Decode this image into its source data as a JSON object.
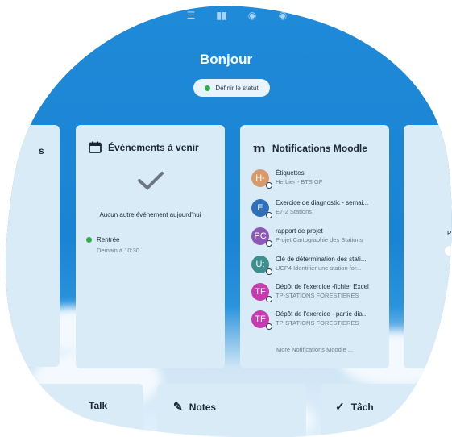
{
  "header": {
    "greeting": "Bonjour",
    "status_button": "Définir le statut",
    "icons": [
      "list-icon",
      "bar-chart-icon",
      "globe-icon",
      "globe-icon"
    ]
  },
  "left_partial_card": {
    "label": "s"
  },
  "events": {
    "title": "Événements à venir",
    "empty_message": "Aucun autre événement aujourd'hui",
    "items": [
      {
        "title": "Rentrée",
        "time": "Demain à 10:30",
        "color": "#2db24a"
      }
    ]
  },
  "moodle": {
    "title": "Notifications Moodle",
    "items": [
      {
        "initials": "H-",
        "title": "Étiquettes",
        "subtitle": "Herbier - BTS GF",
        "color": "#d89a6a"
      },
      {
        "initials": "E",
        "title": "Exercice de diagnostic - semai...",
        "subtitle": "E7-2 Stations",
        "color": "#2d6fb8"
      },
      {
        "initials": "PC",
        "title": "rapport de projet",
        "subtitle": "Projet Cartographie des Stations",
        "color": "#8c57b5"
      },
      {
        "initials": "U:",
        "title": "Clé de détermination des stati...",
        "subtitle": "UCP4 Identifier une station for...",
        "color": "#3f8f8f"
      },
      {
        "initials": "TF",
        "title": "Dépôt de l'exercice -fichier Excel",
        "subtitle": "TP-STATIONS FORESTIERES",
        "color": "#c63bb0"
      },
      {
        "initials": "TF",
        "title": "Dépôt de l'exercice - partie dia...",
        "subtitle": "TP-STATIONS FORESTIERES",
        "color": "#c63bb0"
      }
    ],
    "more": "More Notifications Moodle ..."
  },
  "right_partial_card": {
    "label": "P"
  },
  "bottom": {
    "talk": "Talk",
    "notes": "Notes",
    "tasks": "Tâch"
  }
}
